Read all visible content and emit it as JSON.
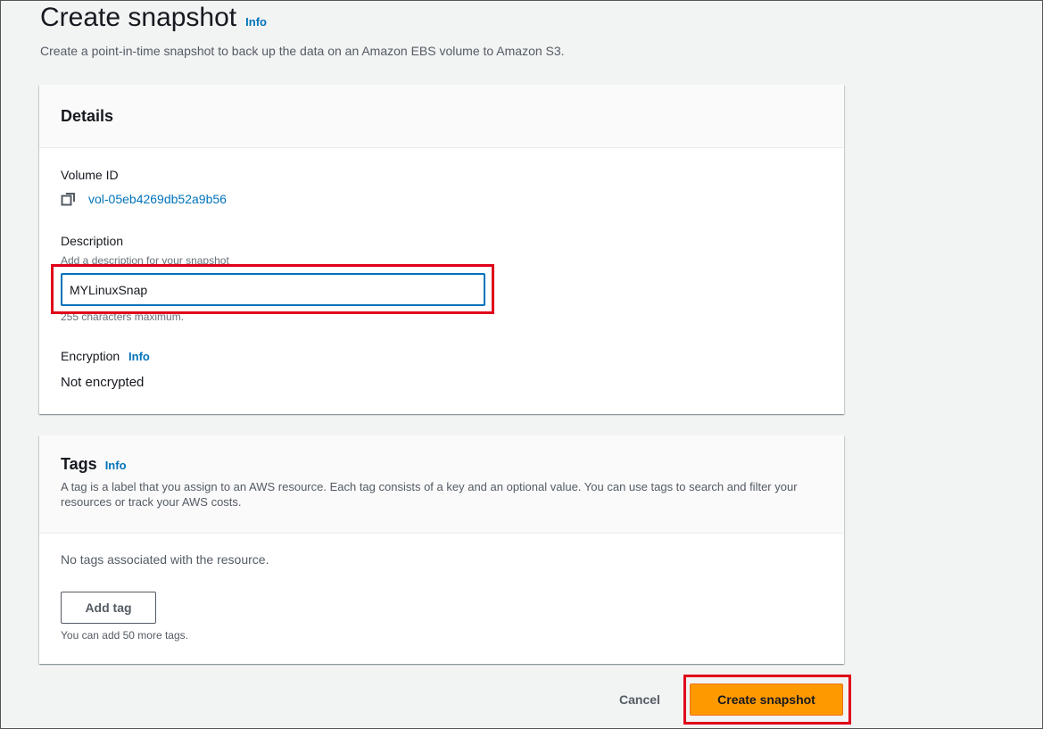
{
  "header": {
    "title": "Create snapshot",
    "info_label": "Info",
    "description": "Create a point-in-time snapshot to back up the data on an Amazon EBS volume to Amazon S3."
  },
  "details": {
    "heading": "Details",
    "volume_id_label": "Volume ID",
    "volume_id": "vol-05eb4269db52a9b56",
    "description_label": "Description",
    "description_hint": "Add a description for your snapshot",
    "description_value": "MYLinuxSnap",
    "description_constraint": "255 characters maximum.",
    "encryption_label": "Encryption",
    "encryption_info": "Info",
    "encryption_value": "Not encrypted"
  },
  "tags": {
    "heading": "Tags",
    "info_label": "Info",
    "description": "A tag is a label that you assign to an AWS resource. Each tag consists of a key and an optional value. You can use tags to search and filter your resources or track your AWS costs.",
    "empty_text": "No tags associated with the resource.",
    "add_button": "Add tag",
    "limit_text": "You can add 50 more tags."
  },
  "actions": {
    "cancel": "Cancel",
    "create": "Create snapshot"
  },
  "colors": {
    "link": "#0073bb",
    "primary_button": "#ff9900",
    "highlight": "#e0001a"
  }
}
